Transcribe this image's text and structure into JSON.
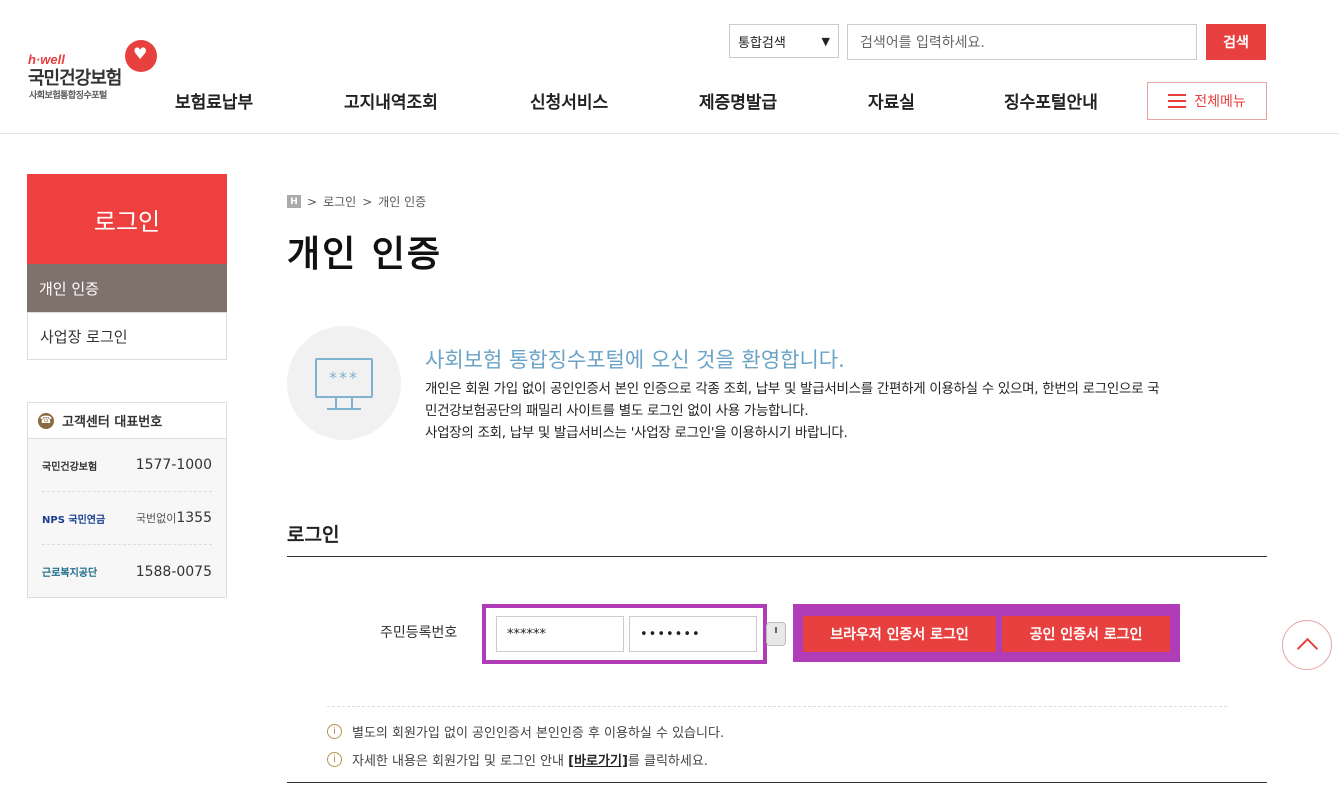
{
  "header": {
    "logo": {
      "brand": "h·well",
      "name": "국민건강보험",
      "sub": "사회보험통합징수포털"
    },
    "search": {
      "scope": "통합검색",
      "placeholder": "검색어를 입력하세요.",
      "button": "검색"
    },
    "nav": [
      "보험료납부",
      "고지내역조회",
      "신청서비스",
      "제증명발급",
      "자료실",
      "징수포털안내"
    ],
    "all_menu": "전체메뉴"
  },
  "sidebar": {
    "title": "로그인",
    "items": [
      {
        "label": "개인 인증",
        "active": true
      },
      {
        "label": "사업장 로그인",
        "active": false
      }
    ],
    "customer_center": {
      "title": "고객센터 대표번호",
      "rows": [
        {
          "org": "국민건강보험",
          "number": "1577-1000",
          "prefix": ""
        },
        {
          "org": "NPS 국민연금",
          "number": "1355",
          "prefix": "국번없이"
        },
        {
          "org": "근로복지공단",
          "number": "1588-0075",
          "prefix": ""
        }
      ]
    }
  },
  "breadcrumb": {
    "home": "H",
    "items": [
      "로그인",
      "개인 인증"
    ]
  },
  "page_title": "개인 인증",
  "welcome": {
    "title": "사회보험 통합징수포털에 오신 것을 환영합니다.",
    "lines": [
      "개인은 회원 가입 없이 공인인증서 본인 인증으로 각종 조회, 납부 및 발급서비스를 간편하게 이용하실 수 있으며, 한번의 로그인으로 국",
      "민건강보험공단의 패밀리 사이트를 별도 로그인 없이 사용 가능합니다.",
      "사업장의 조회, 납부 및 발급서비스는 '사업장 로그인'을 이용하시기 바랍니다."
    ],
    "icon_stars": "***"
  },
  "login": {
    "heading": "로그인",
    "rrn_label": "주민등록번호",
    "rrn_front": "******",
    "rrn_back": "•••••••",
    "browser_btn": "브라우저 인증서 로그인",
    "cert_btn": "공인 인증서 로그인",
    "notes": [
      {
        "before": "별도의 회원가입 없이 공인인증서 본인인증 후 이용하실 수 있습니다.",
        "link": "",
        "after": ""
      },
      {
        "before": "자세한 내용은 회원가입 및 로그인 안내 ",
        "link": "[바로가기]",
        "after": "를 클릭하세요."
      }
    ]
  },
  "colors": {
    "accent": "#e8403f",
    "highlight": "#b03cb8",
    "sidebar_active": "#7f716b",
    "welcome": "#6aa3c6"
  }
}
